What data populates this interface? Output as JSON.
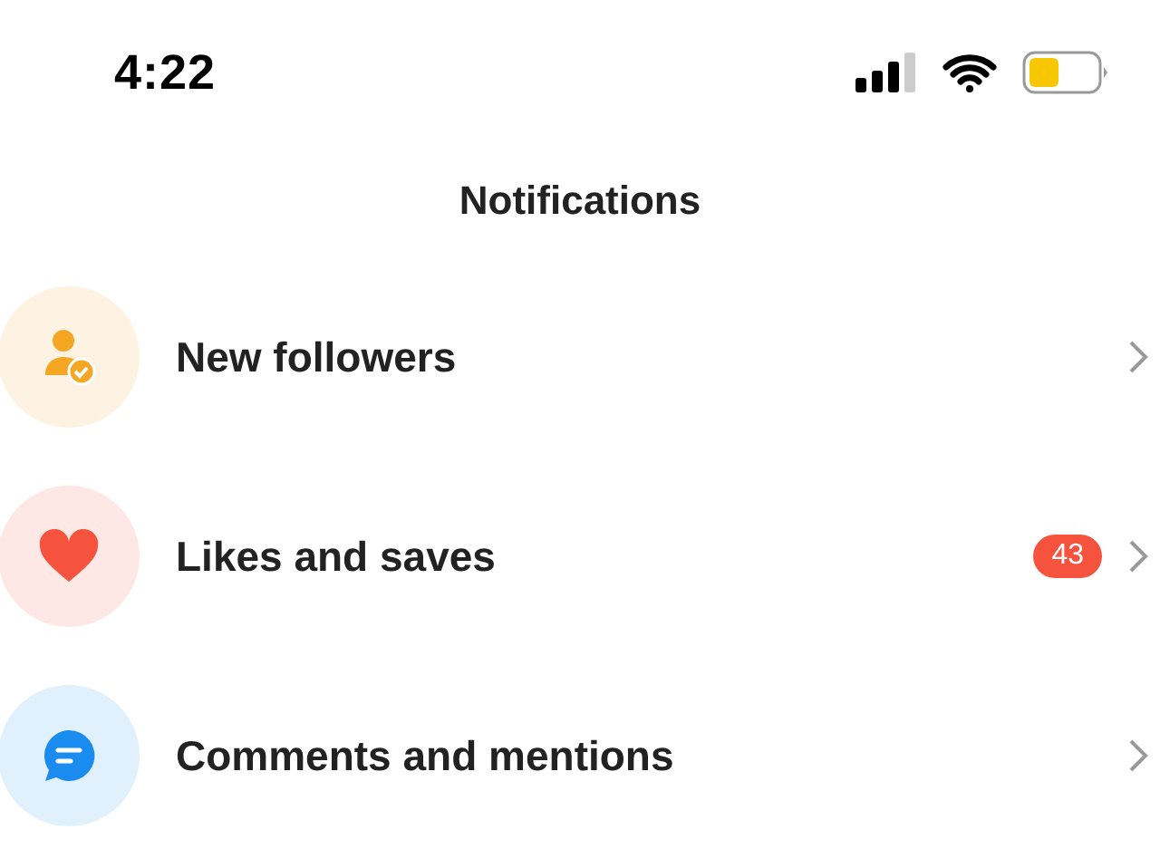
{
  "status_bar": {
    "time": "4:22"
  },
  "header": {
    "title": "Notifications"
  },
  "items": [
    {
      "kind": "followers",
      "label": "New followers",
      "color": "#f5a623"
    },
    {
      "kind": "likes",
      "label": "Likes and saves",
      "color": "#f5533d",
      "badge": "43"
    },
    {
      "kind": "comments",
      "label": "Comments and mentions",
      "color": "#1a8cf0"
    }
  ]
}
